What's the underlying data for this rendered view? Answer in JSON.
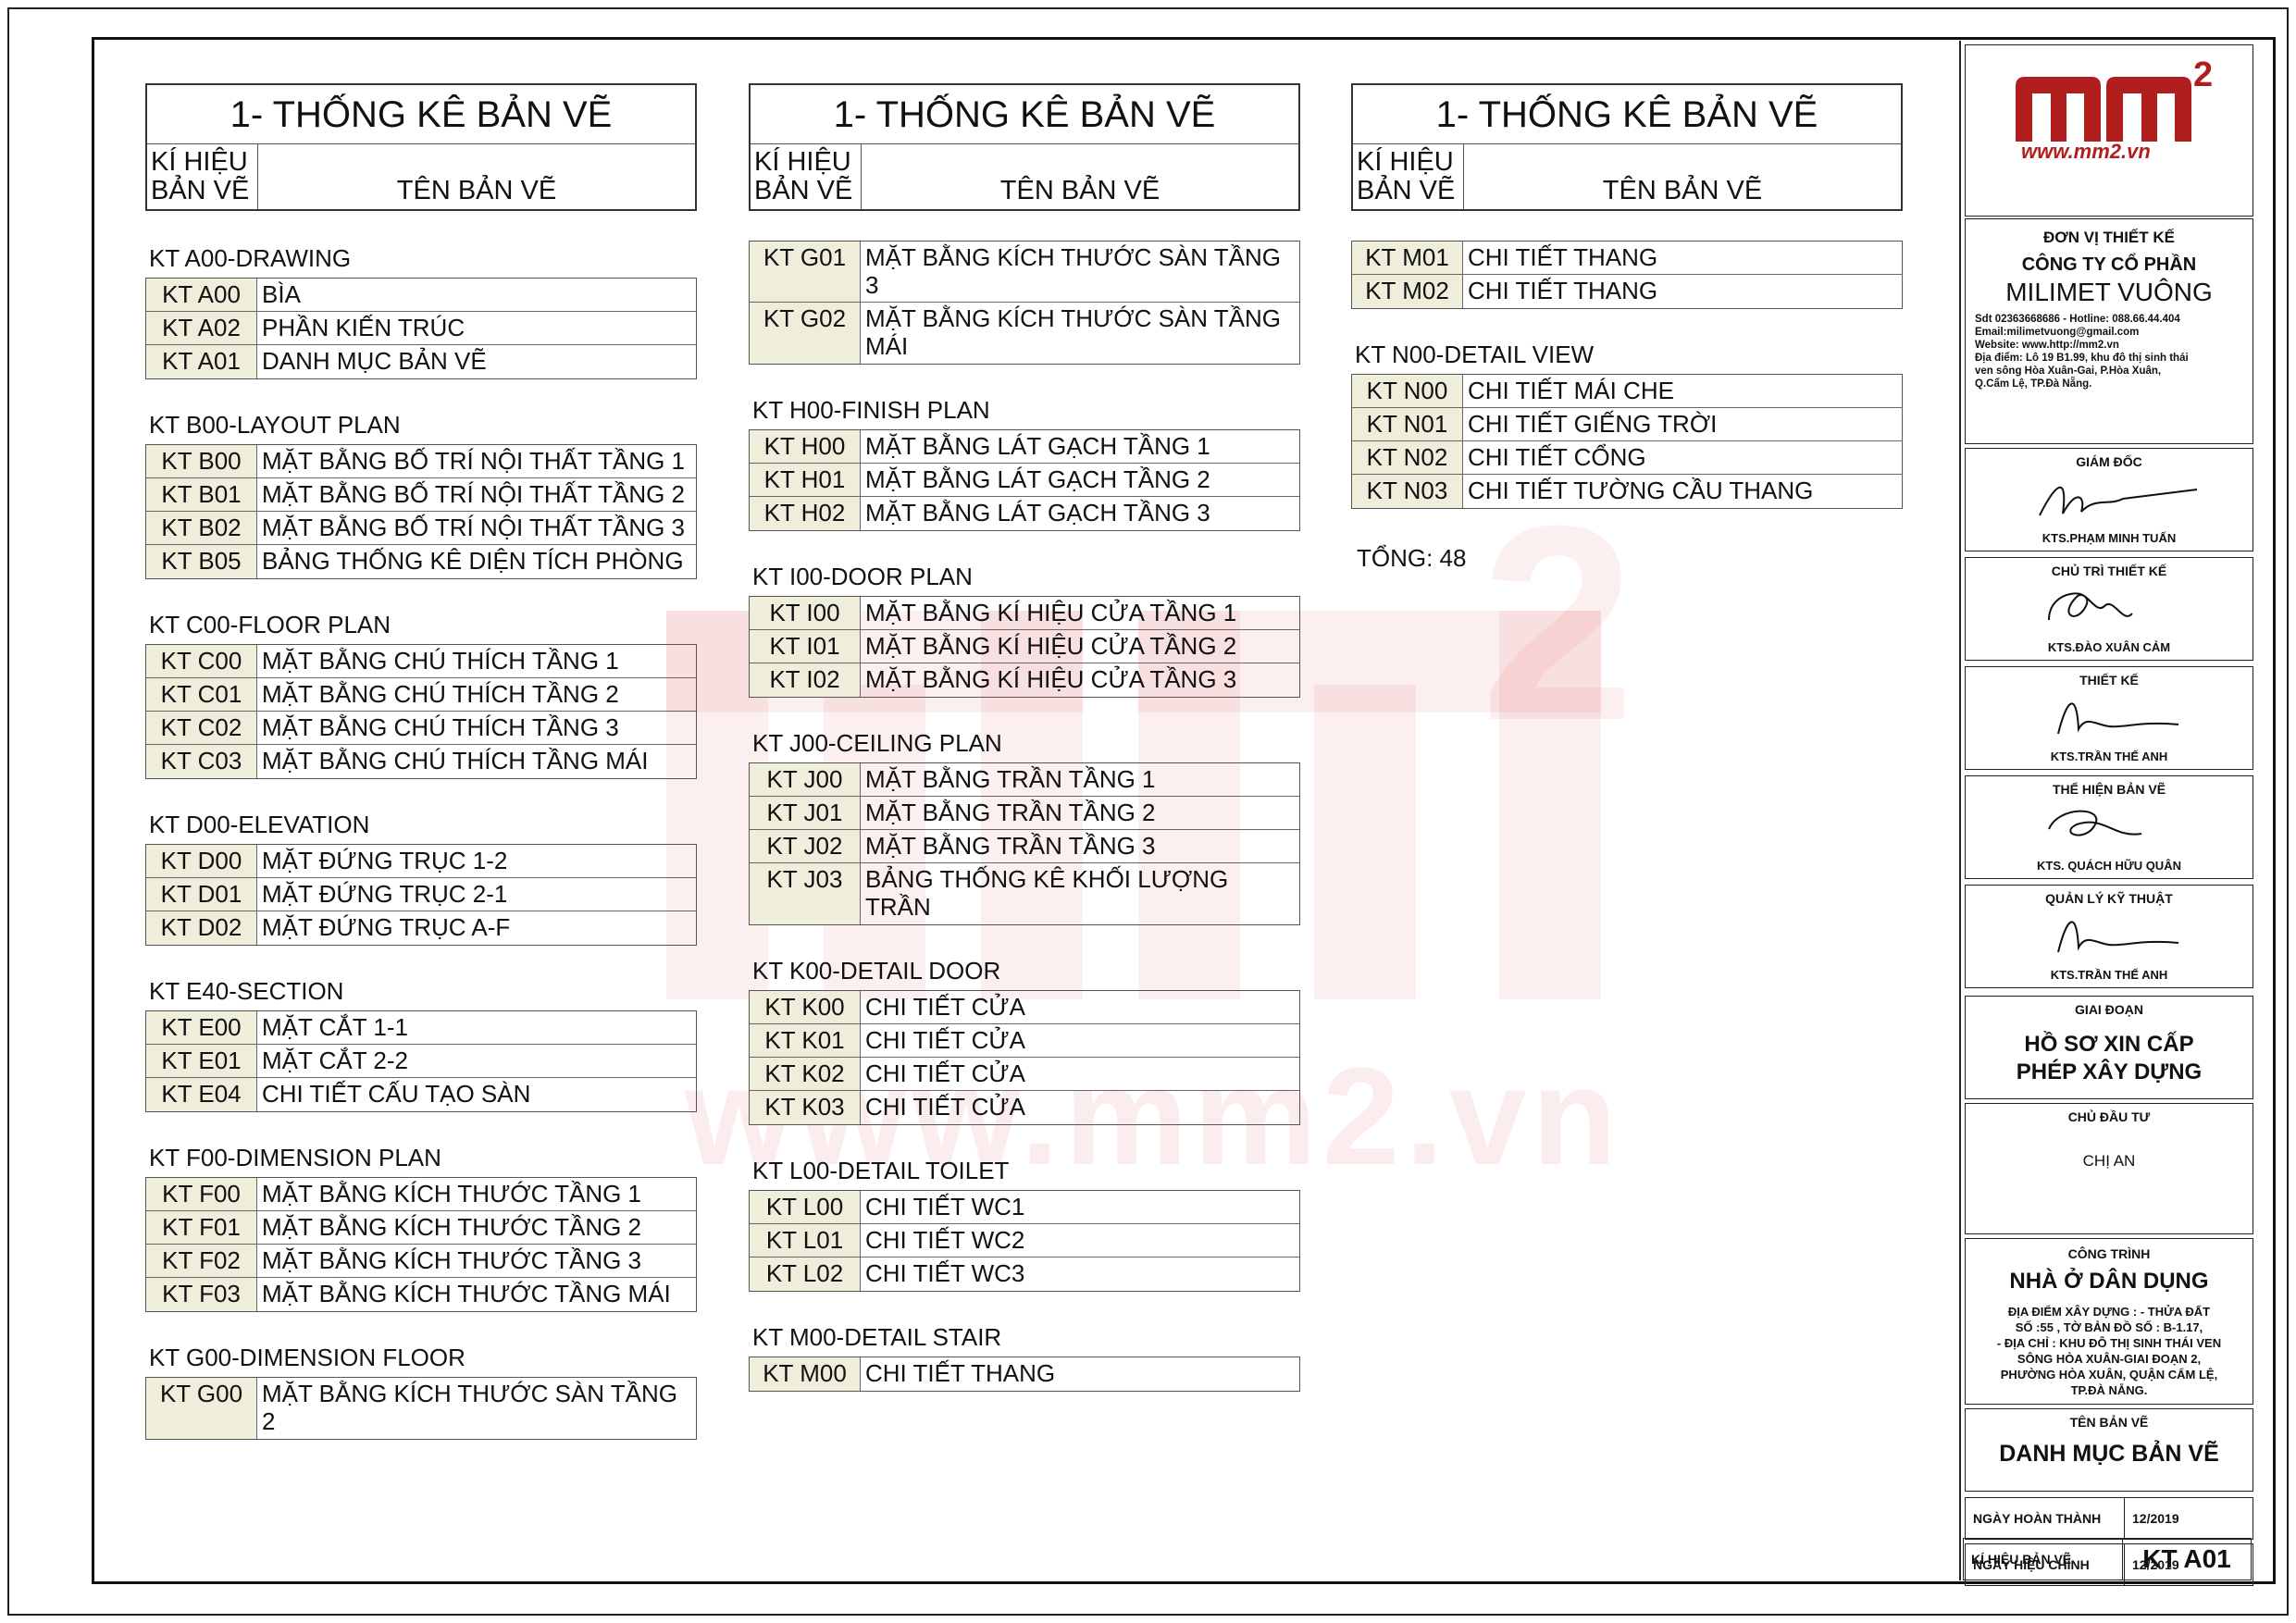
{
  "header": {
    "title": "1- THỐNG KÊ BẢN VẼ",
    "code_label_1": "KÍ HIỆU",
    "code_label_2": "BẢN VẼ",
    "name_label": "TÊN BẢN VẼ"
  },
  "col1": [
    {
      "group": "KT A00-DRAWING",
      "rows": [
        {
          "code": "KT A00",
          "name": "BÌA"
        },
        {
          "code": "KT A02",
          "name": "PHẦN KIẾN TRÚC"
        },
        {
          "code": "KT A01",
          "name": "DANH MỤC BẢN VẼ"
        }
      ]
    },
    {
      "group": "KT B00-LAYOUT PLAN",
      "rows": [
        {
          "code": "KT B00",
          "name": "MẶT BẰNG BỐ TRÍ NỘI THẤT TẦNG 1"
        },
        {
          "code": "KT B01",
          "name": "MẶT BẰNG BỐ TRÍ NỘI THẤT TẦNG 2"
        },
        {
          "code": "KT B02",
          "name": "MẶT BẰNG BỐ TRÍ NỘI THẤT TẦNG 3"
        },
        {
          "code": "KT B05",
          "name": "BẢNG THỐNG KÊ DIỆN TÍCH PHÒNG"
        }
      ]
    },
    {
      "group": "KT C00-FLOOR PLAN",
      "rows": [
        {
          "code": "KT C00",
          "name": "MẶT BẰNG CHÚ THÍCH TẦNG 1"
        },
        {
          "code": "KT C01",
          "name": "MẶT BẰNG CHÚ THÍCH TẦNG 2"
        },
        {
          "code": "KT C02",
          "name": "MẶT BẰNG CHÚ THÍCH TẦNG 3"
        },
        {
          "code": "KT C03",
          "name": "MẶT BẰNG CHÚ THÍCH TẦNG MÁI"
        }
      ]
    },
    {
      "group": "KT D00-ELEVATION",
      "rows": [
        {
          "code": "KT D00",
          "name": "MẶT ĐỨNG TRỤC 1-2"
        },
        {
          "code": "KT D01",
          "name": "MẶT ĐỨNG TRỤC 2-1"
        },
        {
          "code": "KT D02",
          "name": "MẶT ĐỨNG TRỤC A-F"
        }
      ]
    },
    {
      "group": "KT E40-SECTION",
      "rows": [
        {
          "code": "KT E00",
          "name": "MẶT CẮT 1-1"
        },
        {
          "code": "KT E01",
          "name": "MẶT CẮT 2-2"
        },
        {
          "code": "KT E04",
          "name": "CHI TIẾT CẤU TẠO SÀN"
        }
      ]
    },
    {
      "group": "KT F00-DIMENSION PLAN",
      "rows": [
        {
          "code": "KT F00",
          "name": "MẶT BẰNG KÍCH THƯỚC TẦNG 1"
        },
        {
          "code": "KT F01",
          "name": "MẶT BẰNG KÍCH THƯỚC TẦNG 2"
        },
        {
          "code": "KT F02",
          "name": "MẶT BẰNG KÍCH THƯỚC TẦNG 3"
        },
        {
          "code": "KT F03",
          "name": "MẶT BẰNG KÍCH THƯỚC TẦNG MÁI"
        }
      ]
    },
    {
      "group": "KT G00-DIMENSION FLOOR",
      "rows": [
        {
          "code": "KT G00",
          "name": "MẶT BẰNG KÍCH THƯỚC SÀN TẦNG 2",
          "tall": true
        }
      ]
    }
  ],
  "col2": [
    {
      "group": "",
      "rows": [
        {
          "code": "KT G01",
          "name": "MẶT BẰNG KÍCH THƯỚC SÀN TẦNG 3",
          "tall": true
        },
        {
          "code": "KT G02",
          "name": "MẶT BẰNG KÍCH THƯỚC SÀN TẦNG MÁI",
          "tall": true
        }
      ]
    },
    {
      "group": "KT H00-FINISH PLAN",
      "rows": [
        {
          "code": "KT H00",
          "name": "MẶT BẰNG LÁT GẠCH TẦNG 1"
        },
        {
          "code": "KT H01",
          "name": "MẶT BẰNG LÁT GẠCH TẦNG 2"
        },
        {
          "code": "KT H02",
          "name": "MẶT BẰNG LÁT GẠCH TẦNG 3"
        }
      ]
    },
    {
      "group": "KT I00-DOOR PLAN",
      "rows": [
        {
          "code": "KT I00",
          "name": "MẶT BẰNG KÍ HIỆU CỬA TẦNG 1"
        },
        {
          "code": "KT I01",
          "name": "MẶT BẰNG KÍ HIỆU CỬA TẦNG 2"
        },
        {
          "code": "KT I02",
          "name": "MẶT BẰNG KÍ HIỆU CỬA TẦNG 3"
        }
      ]
    },
    {
      "group": "KT J00-CEILING PLAN",
      "rows": [
        {
          "code": "KT J00",
          "name": "MẶT BẰNG TRẦN TẦNG 1"
        },
        {
          "code": "KT J01",
          "name": "MẶT BẰNG TRẦN TẦNG 2"
        },
        {
          "code": "KT J02",
          "name": "MẶT BẰNG TRẦN TẦNG 3"
        },
        {
          "code": "KT J03",
          "name": "BẢNG THỐNG KÊ KHỐI LƯỢNG TRẦN",
          "tall": true
        }
      ]
    },
    {
      "group": "KT K00-DETAIL DOOR",
      "rows": [
        {
          "code": "KT K00",
          "name": "CHI TIẾT CỬA"
        },
        {
          "code": "KT K01",
          "name": "CHI TIẾT CỬA"
        },
        {
          "code": "KT K02",
          "name": "CHI TIẾT CỬA"
        },
        {
          "code": "KT K03",
          "name": "CHI TIẾT CỬA"
        }
      ]
    },
    {
      "group": "KT L00-DETAIL TOILET",
      "rows": [
        {
          "code": "KT L00",
          "name": "CHI TIẾT  WC1"
        },
        {
          "code": "KT L01",
          "name": "CHI TIẾT WC2"
        },
        {
          "code": "KT L02",
          "name": "CHI TIẾT WC3"
        }
      ]
    },
    {
      "group": "KT M00-DETAIL STAIR",
      "rows": [
        {
          "code": "KT M00",
          "name": "CHI TIẾT THANG"
        }
      ]
    }
  ],
  "col3": [
    {
      "group": "",
      "rows": [
        {
          "code": "KT M01",
          "name": "CHI TIẾT THANG"
        },
        {
          "code": "KT M02",
          "name": "CHI TIẾT THANG"
        }
      ]
    },
    {
      "group": "KT N00-DETAIL VIEW",
      "rows": [
        {
          "code": "KT N00",
          "name": "CHI TIẾT MÁI CHE"
        },
        {
          "code": "KT N01",
          "name": "CHI TIẾT GIẾNG TRỜI"
        },
        {
          "code": "KT N02",
          "name": "CHI TIẾT CỔNG"
        },
        {
          "code": "KT N03",
          "name": "CHI TIẾT TƯỜNG CẦU THANG"
        }
      ]
    }
  ],
  "total": "TỔNG: 48",
  "watermark": {
    "text": "www.mm2.vn",
    "sup": "2"
  },
  "title_block": {
    "logo_text": "www.mm2.vn",
    "unit_label": "ĐƠN VỊ THIẾT KẾ",
    "company_line1": "CÔNG TY CỔ PHẦN",
    "company_line2": "MILIMET VUÔNG",
    "contact": [
      "Sdt 02363668686 - Hotline: 088.66.44.404",
      "Email:milimetvuong@gmail.com",
      "Website: www.http://mm2.vn",
      "Địa điểm: Lô 19 B1.99, khu đô thị sinh thái",
      "ven sông Hòa Xuân-Gai, P.Hòa Xuân,",
      "Q.Cẩm Lệ, TP.Đà Nẵng."
    ],
    "signatures": [
      {
        "role": "GIÁM ĐỐC",
        "name": "KTS.PHẠM MINH TUẤN"
      },
      {
        "role": "CHỦ TRÌ THIẾT KẾ",
        "name": "KTS.ĐÀO XUÂN CẢM"
      },
      {
        "role": "THIẾT KẾ",
        "name": "KTS.TRẦN THẾ ANH"
      },
      {
        "role": "THỂ HIỆN BẢN VẼ",
        "name": "KTS. QUÁCH HỮU QUÂN"
      },
      {
        "role": "QUẢN LÝ KỸ THUẬT",
        "name": "KTS.TRẦN THẾ ANH"
      }
    ],
    "phase_label": "GIAI ĐOẠN",
    "phase_line1": "HỒ SƠ XIN CẤP",
    "phase_line2": "PHÉP XÂY DỰNG",
    "owner_label": "CHỦ ĐẦU TƯ",
    "owner": "CHỊ AN",
    "project_label": "CÔNG TRÌNH",
    "project_name": "NHÀ Ở DÂN DỤNG",
    "project_address": [
      "ĐỊA ĐIỂM XÂY DỰNG : - THỬA ĐẤT",
      "SỐ :55 , TỜ BẢN ĐỒ SỐ : B-1.17,",
      "- ĐỊA CHỈ : KHU ĐÔ THỊ SINH THÁI VEN",
      "SÔNG HÒA XUÂN-GIAI ĐOẠN 2,",
      "PHƯỜNG HÒA XUÂN, QUẬN CẨM LỆ,",
      "TP.ĐÀ NẴNG."
    ],
    "drawing_name_label": "TÊN BẢN VẼ",
    "drawing_name": "DANH MỤC BẢN VẼ",
    "completed_label": "NGÀY HOÀN THÀNH",
    "completed": "12/2019",
    "revised_label": "NGÀY HIỆU CHỈNH",
    "revised": "12/2019",
    "sheet_code_label": "KÍ HIỆU BẢN VẼ",
    "sheet_code": "KT A01"
  },
  "colors": {
    "logo_red": "#b01e1e",
    "code_bg": "#efeedb",
    "watermark": "#d63838"
  }
}
